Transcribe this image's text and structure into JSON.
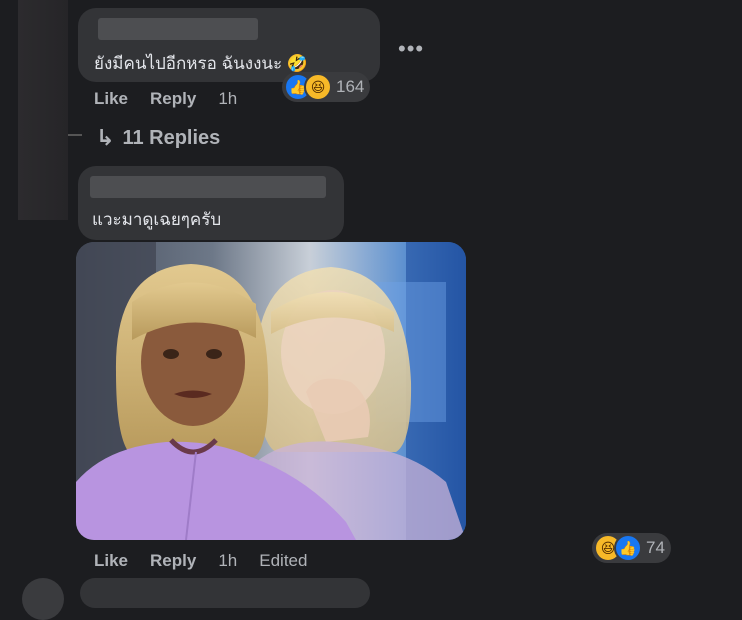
{
  "comment1": {
    "text": "ยังมีคนไปอีกหรอ ฉันงงนะ 🤣",
    "reaction_count": "164",
    "actions": {
      "like": "Like",
      "reply": "Reply",
      "time": "1h"
    },
    "more": "•••"
  },
  "replies": {
    "label": "11 Replies",
    "arrow": "↳"
  },
  "comment2": {
    "text": "แวะมาดูเฉยๆครับ",
    "reaction_count": "74",
    "actions": {
      "like": "Like",
      "reply": "Reply",
      "time": "1h",
      "edited": "Edited"
    }
  },
  "icons": {
    "like": "thumbs-up-icon",
    "haha": "laughing-face-icon",
    "rofl": "rolling-laughing-emoji"
  },
  "colors": {
    "background": "#1c1d20",
    "bubble": "#333437",
    "secondary_text": "#b0b3b8",
    "like_blue": "#1877f2",
    "haha_yellow": "#f7b928"
  }
}
